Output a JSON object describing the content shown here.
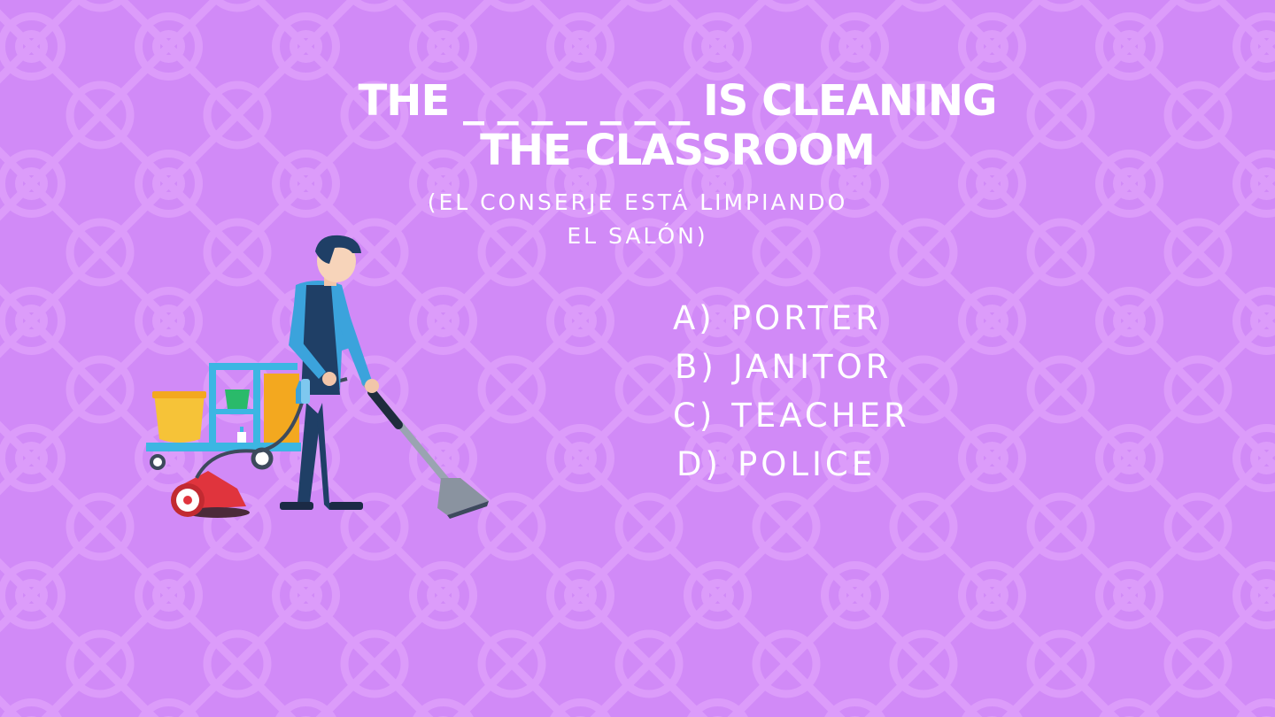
{
  "slide": {
    "background_color": "#d18af7",
    "pattern_color": "#dc9cfa",
    "title_lines": [
      "THE _ _ _ _ _ _ _ IS CLEANING",
      "THE CLASSROOM"
    ],
    "translation_lines": [
      "(EL CONSERJE ESTÁ LIMPIANDO",
      "EL SALÓN)"
    ],
    "options": [
      {
        "letter": "A)",
        "text": "PORTER"
      },
      {
        "letter": "B)",
        "text": "JANITOR"
      },
      {
        "letter": "C)",
        "text": "TEACHER"
      },
      {
        "letter": "D)",
        "text": "POLICE"
      }
    ],
    "illustration": "janitor-vacuuming-with-cleaning-cart"
  }
}
